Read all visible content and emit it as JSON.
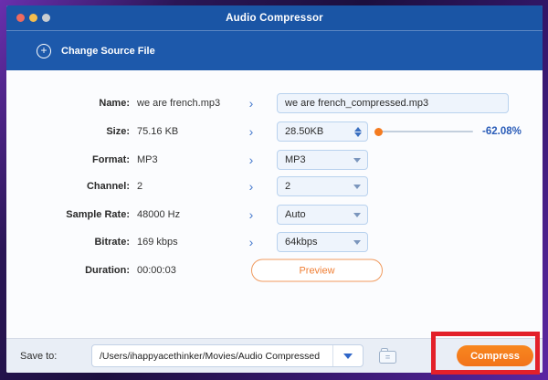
{
  "titlebar": {
    "title": "Audio Compressor"
  },
  "header": {
    "change_source_file": "Change Source File"
  },
  "form": {
    "rows": [
      {
        "label": "Name:",
        "source": "we are french.mp3",
        "target": "we are french_compressed.mp3"
      },
      {
        "label": "Size:",
        "source": "75.16 KB",
        "target": "28.50KB",
        "compression": "-62.08%"
      },
      {
        "label": "Format:",
        "source": "MP3",
        "target": "MP3"
      },
      {
        "label": "Channel:",
        "source": "2",
        "target": "2"
      },
      {
        "label": "Sample Rate:",
        "source": "48000 Hz",
        "target": "Auto"
      },
      {
        "label": "Bitrate:",
        "source": "169 kbps",
        "target": "64kbps"
      },
      {
        "label": "Duration:",
        "source": "00:00:03"
      }
    ],
    "preview_button": "Preview"
  },
  "footer": {
    "save_to_label": "Save to:",
    "save_path": "/Users/ihappyacethinker/Movies/Audio Compressed",
    "compress_button": "Compress"
  },
  "colors": {
    "titlebar_blue": "#1a55a5",
    "accent_orange": "#f47b20",
    "annotation_red": "#e3202a",
    "percent_blue": "#2a5cb8"
  }
}
